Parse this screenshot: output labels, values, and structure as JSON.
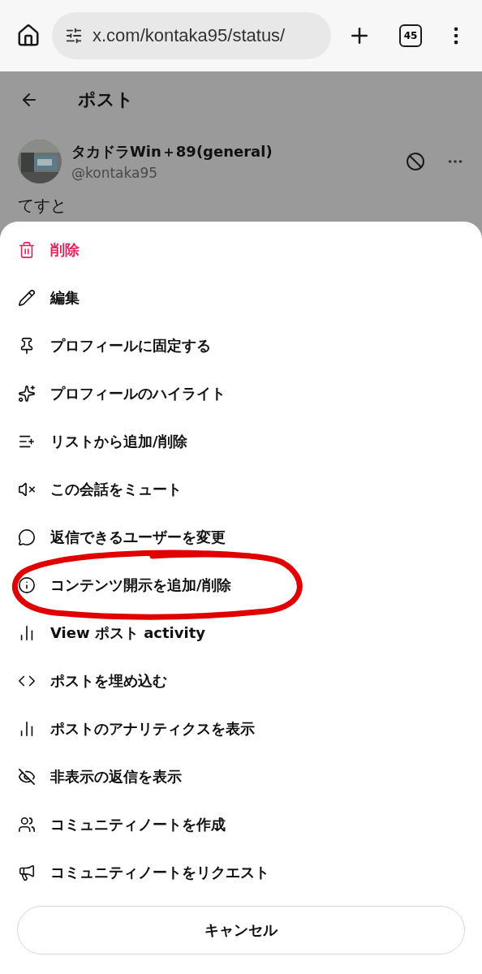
{
  "browser": {
    "url": "x.com/kontaka95/status/",
    "tab_count": "45"
  },
  "page": {
    "title": "ポスト",
    "post": {
      "author": "タカドラWin＋89(general)",
      "handle": "@kontaka95",
      "text": "てすと"
    }
  },
  "sheet": {
    "items": [
      {
        "label": "削除",
        "destructive": true,
        "circled": false
      },
      {
        "label": "編集",
        "destructive": false,
        "circled": false
      },
      {
        "label": "プロフィールに固定する",
        "destructive": false,
        "circled": false
      },
      {
        "label": "プロフィールのハイライト",
        "destructive": false,
        "circled": false
      },
      {
        "label": "リストから追加/削除",
        "destructive": false,
        "circled": false
      },
      {
        "label": "この会話をミュート",
        "destructive": false,
        "circled": false
      },
      {
        "label": "返信できるユーザーを変更",
        "destructive": false,
        "circled": false
      },
      {
        "label": "コンテンツ開示を追加/削除",
        "destructive": false,
        "circled": true
      },
      {
        "label": "View ポスト activity",
        "destructive": false,
        "circled": false
      },
      {
        "label": "ポストを埋め込む",
        "destructive": false,
        "circled": false
      },
      {
        "label": "ポストのアナリティクスを表示",
        "destructive": false,
        "circled": false
      },
      {
        "label": "非表示の返信を表示",
        "destructive": false,
        "circled": false
      },
      {
        "label": "コミュニティノートを作成",
        "destructive": false,
        "circled": false
      },
      {
        "label": "コミュニティノートをリクエスト",
        "destructive": false,
        "circled": false
      }
    ],
    "cancel": "キャンセル"
  }
}
